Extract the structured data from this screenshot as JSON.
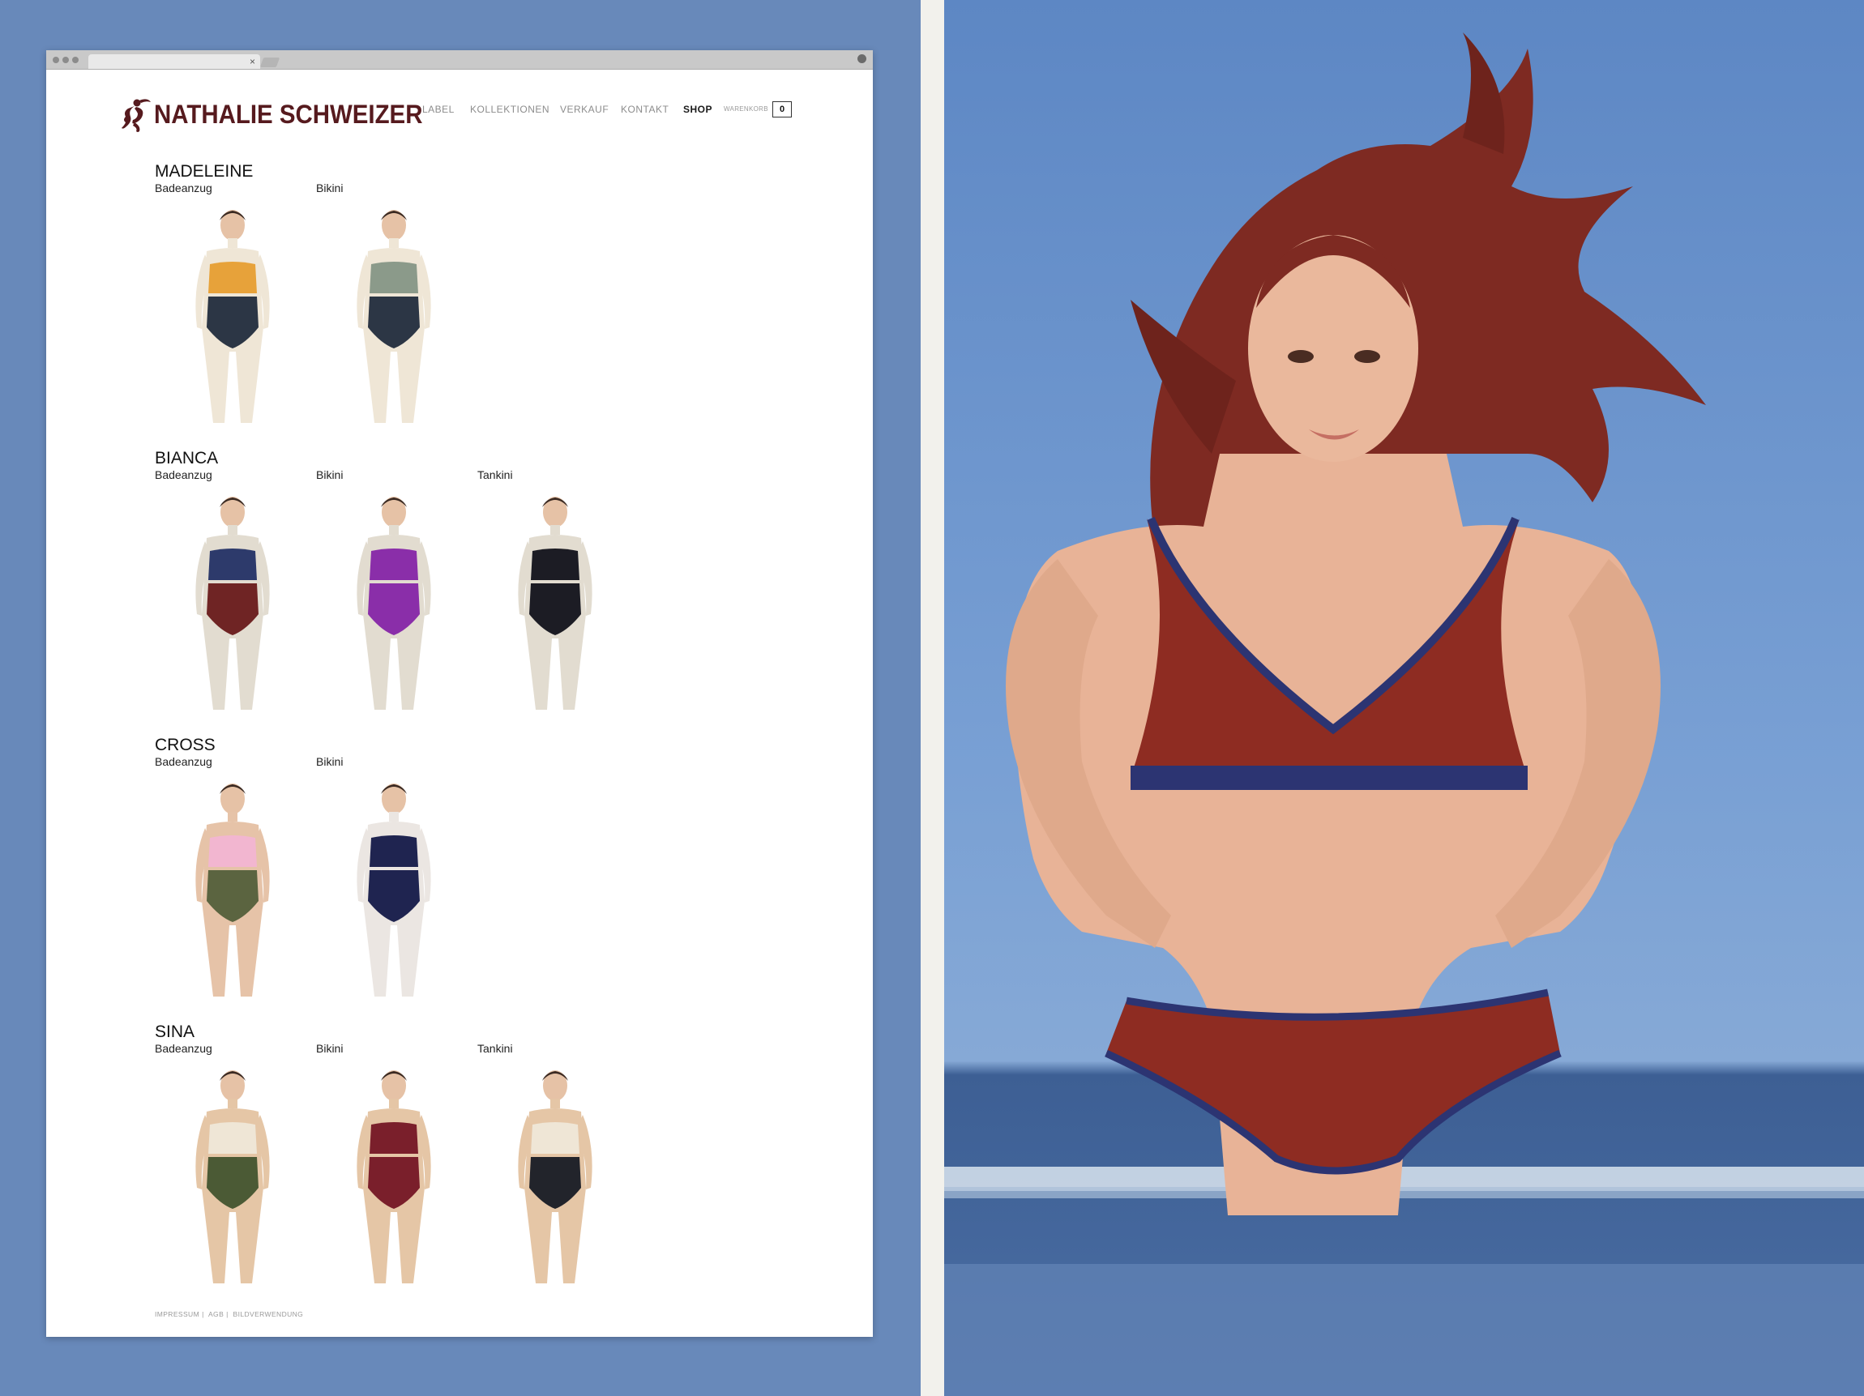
{
  "site": {
    "brand": "NATHALIE SCHWEIZER",
    "brand_color": "#561a1e",
    "nav": [
      {
        "label": "LABEL",
        "active": false
      },
      {
        "label": "KOLLEKTIONEN",
        "active": false
      },
      {
        "label": "VERKAUF",
        "active": false
      },
      {
        "label": "KONTAKT",
        "active": false
      },
      {
        "label": "SHOP",
        "active": true
      }
    ],
    "cart": {
      "label": "WARENKORB",
      "count": "0"
    }
  },
  "collections": [
    {
      "name": "MADELEINE",
      "items": [
        {
          "type": "Badeanzug",
          "garment": "striped one-piece",
          "colors": [
            "#2c3645",
            "#e7a23a",
            "#efe6d6"
          ]
        },
        {
          "type": "Bikini",
          "garment": "striped bikini",
          "colors": [
            "#2c3645",
            "#8b9a8a",
            "#efe6d6"
          ]
        }
      ]
    },
    {
      "name": "BIANCA",
      "items": [
        {
          "type": "Badeanzug",
          "garment": "maroon one-piece",
          "colors": [
            "#6f2424",
            "#2d3a6b",
            "#e2dcd0"
          ]
        },
        {
          "type": "Bikini",
          "garment": "purple bikini",
          "colors": [
            "#8a2ea9",
            "#8a2ea9",
            "#e2dcd0"
          ]
        },
        {
          "type": "Tankini",
          "garment": "black tankini",
          "colors": [
            "#1c1c24",
            "#1c1c24",
            "#e2dcd0"
          ]
        }
      ]
    },
    {
      "name": "CROSS",
      "items": [
        {
          "type": "Badeanzug",
          "garment": "pink and olive one-piece",
          "colors": [
            "#5b6440",
            "#f2b6d0",
            "#e6c3a8"
          ]
        },
        {
          "type": "Bikini",
          "garment": "navy bikini back view",
          "colors": [
            "#1f2450",
            "#1f2450",
            "#ebe6e2"
          ]
        }
      ]
    },
    {
      "name": "SINA",
      "items": [
        {
          "type": "Badeanzug",
          "garment": "olive one-piece",
          "colors": [
            "#4b5a35",
            "#efe6d6",
            "#e5c6a6"
          ]
        },
        {
          "type": "Bikini",
          "garment": "maroon bikini",
          "colors": [
            "#7a1f2b",
            "#7a1f2b",
            "#e5c6a6"
          ]
        },
        {
          "type": "Tankini",
          "garment": "black tankini",
          "colors": [
            "#22242b",
            "#efe6d6",
            "#e5c6a6"
          ]
        }
      ]
    }
  ],
  "footer": {
    "links": [
      "IMPRESSUM",
      "AGB",
      "BILDVERWENDUNG"
    ]
  },
  "hero": {
    "background": "beach, sea and blue sky",
    "subject": "woman in red halter bikini with navy trim",
    "bikini_color": "#8e2c22",
    "trim_color": "#2c3472"
  }
}
